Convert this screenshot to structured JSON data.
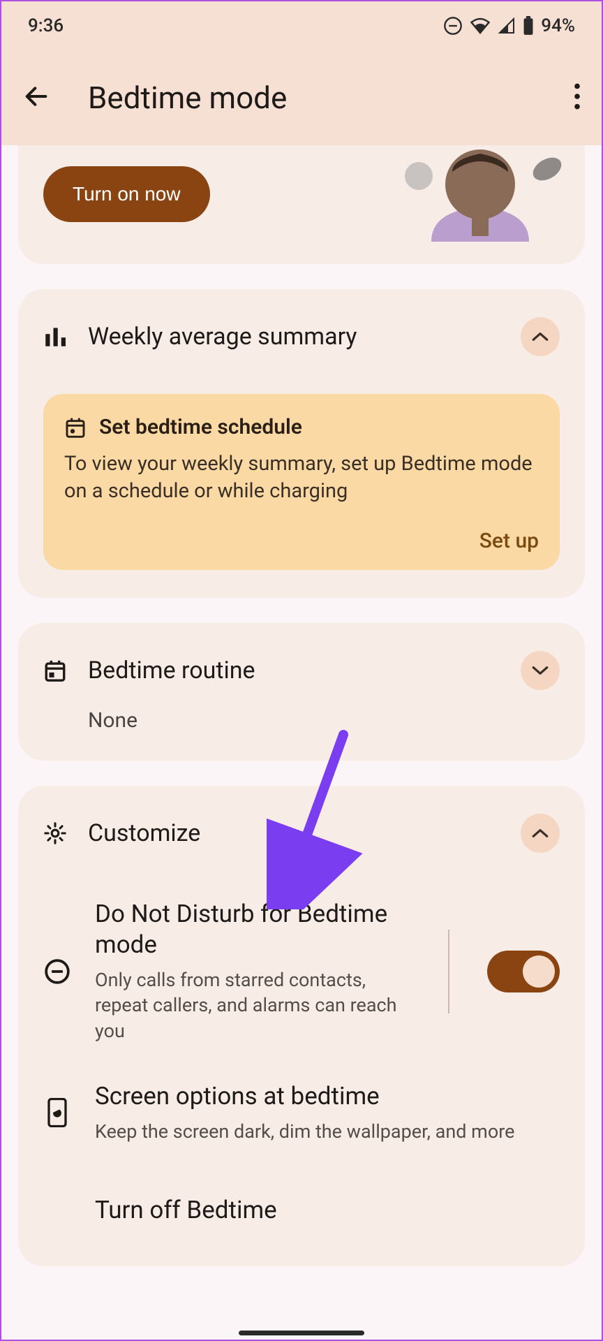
{
  "status": {
    "time": "9:36",
    "battery_pct": "94%"
  },
  "header": {
    "title": "Bedtime mode"
  },
  "hero": {
    "turn_on_label": "Turn on now"
  },
  "weekly": {
    "title": "Weekly average summary",
    "banner": {
      "title": "Set bedtime schedule",
      "body": "To view your weekly summary, set up Bedtime mode on a schedule or while charging",
      "action": "Set up"
    }
  },
  "routine": {
    "title": "Bedtime routine",
    "value": "None"
  },
  "customize": {
    "title": "Customize",
    "dnd": {
      "title": "Do Not Disturb for Bedtime mode",
      "desc": "Only calls from starred contacts, repeat callers, and alarms can reach you",
      "enabled": true
    },
    "screen": {
      "title": "Screen options at bedtime",
      "desc": "Keep the screen dark, dim the wallpaper, and more"
    },
    "turnoff": {
      "title": "Turn off Bedtime"
    }
  }
}
